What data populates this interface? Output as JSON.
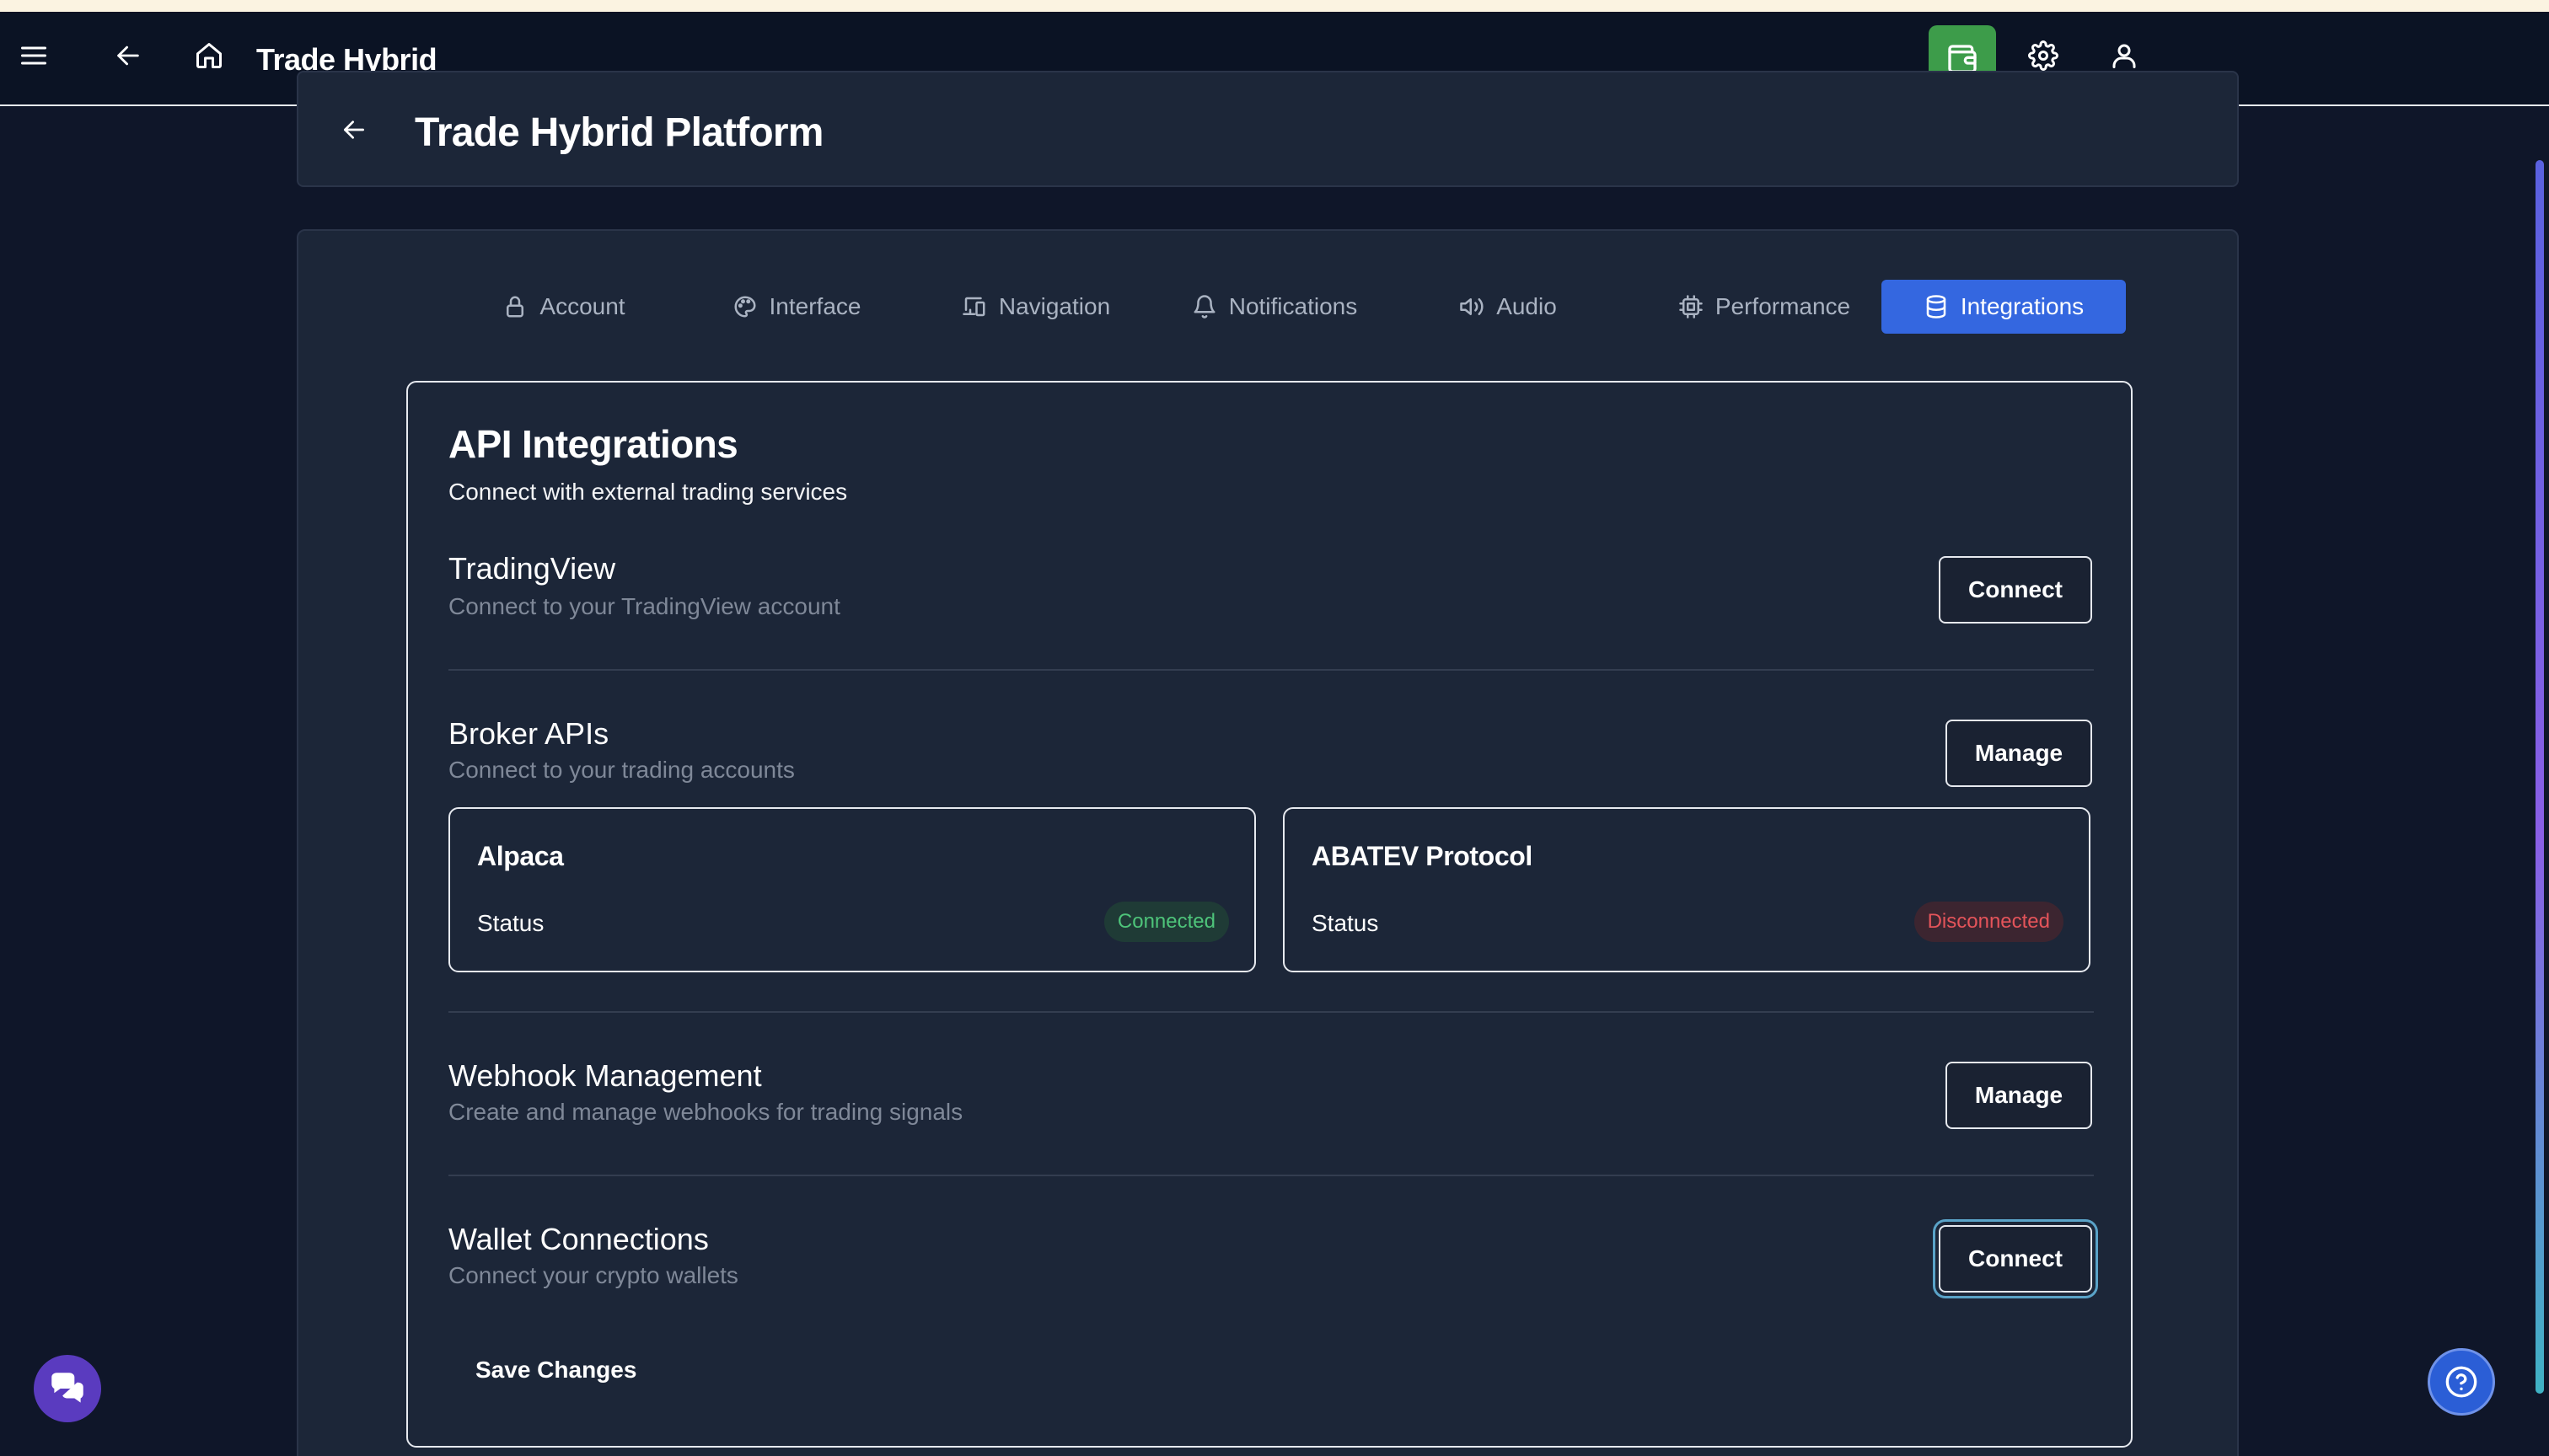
{
  "app": {
    "title": "Trade Hybrid"
  },
  "topbar": {
    "icons": [
      "menu-icon",
      "back-arrow-icon",
      "home-icon",
      "wallet-icon",
      "gear-icon",
      "user-icon"
    ],
    "wallet_color": "#3d9c4a"
  },
  "header": {
    "title": "Trade Hybrid Platform"
  },
  "tabs": [
    {
      "label": "Account",
      "icon": "lock-icon"
    },
    {
      "label": "Interface",
      "icon": "palette-icon"
    },
    {
      "label": "Navigation",
      "icon": "devices-icon"
    },
    {
      "label": "Notifications",
      "icon": "bell-icon"
    },
    {
      "label": "Audio",
      "icon": "speaker-icon"
    },
    {
      "label": "Performance",
      "icon": "cpu-icon"
    },
    {
      "label": "Integrations",
      "icon": "database-icon"
    }
  ],
  "active_tab": "Integrations",
  "accent_color": "#3467e0",
  "integrations": {
    "title": "API Integrations",
    "subtitle": "Connect with external trading services",
    "tradingview": {
      "title": "TradingView",
      "desc": "Connect to your TradingView account",
      "button": "Connect"
    },
    "broker": {
      "title": "Broker APIs",
      "desc": "Connect to your trading accounts",
      "button": "Manage",
      "cards": [
        {
          "name": "Alpaca",
          "status_label": "Status",
          "status": "Connected",
          "status_color": "#4ec47a"
        },
        {
          "name": "ABATEV Protocol",
          "status_label": "Status",
          "status": "Disconnected",
          "status_color": "#e4545a"
        }
      ]
    },
    "webhook": {
      "title": "Webhook Management",
      "desc": "Create and manage webhooks for trading signals",
      "button": "Manage"
    },
    "wallet": {
      "title": "Wallet Connections",
      "desc": "Connect your crypto wallets",
      "button": "Connect"
    },
    "save_label": "Save Changes"
  }
}
